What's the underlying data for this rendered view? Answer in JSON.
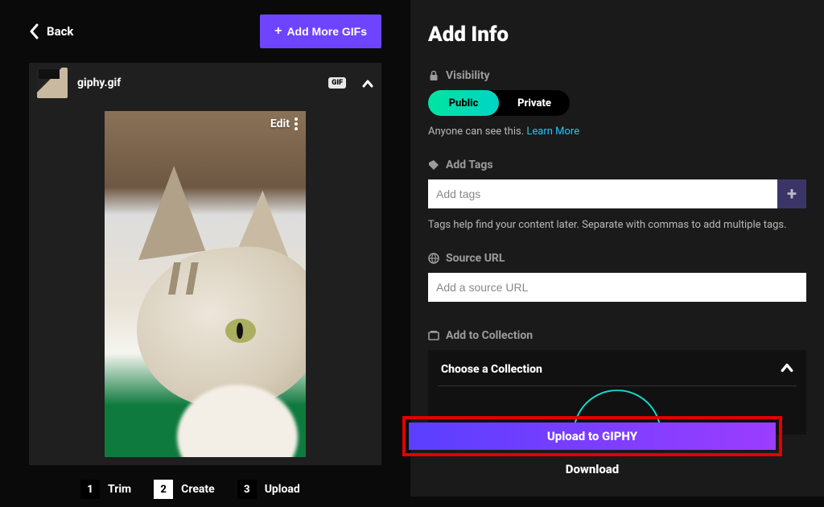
{
  "left": {
    "back_label": "Back",
    "add_more_label": "Add More GIFs",
    "file_name": "giphy.gif",
    "gif_badge": "GIF",
    "edit_label": "Edit"
  },
  "steps": [
    {
      "num": "1",
      "label": "Trim"
    },
    {
      "num": "2",
      "label": "Create"
    },
    {
      "num": "3",
      "label": "Upload"
    }
  ],
  "active_step": 1,
  "right": {
    "title": "Add Info",
    "visibility_label": "Visibility",
    "public_label": "Public",
    "private_label": "Private",
    "visibility_hint": "Anyone can see this. ",
    "learn_more": "Learn More",
    "tags_label": "Add Tags",
    "tags_placeholder": "Add tags",
    "tags_hint": "Tags help find your content later. Separate with commas to add multiple tags.",
    "source_label": "Source URL",
    "source_placeholder": "Add a source URL",
    "collection_label": "Add to Collection",
    "choose_collection": "Choose a Collection",
    "upload_label": "Upload to GIPHY",
    "download_label": "Download"
  }
}
